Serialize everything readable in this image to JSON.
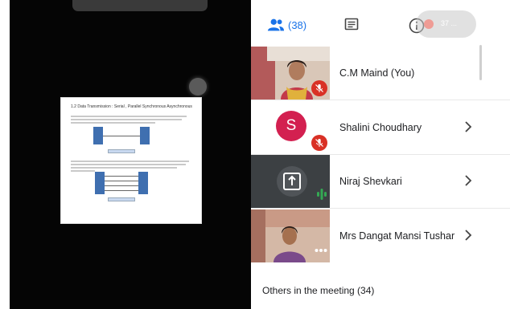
{
  "presentation": {
    "slide_title": "1.2 Data Transmission : Serial , Parallel Synchronous Asynchronous"
  },
  "tabs": {
    "people_count": "(38)"
  },
  "overlay": {
    "timer_text": "37 ..."
  },
  "participants": [
    {
      "name": "C.M Maind (You)",
      "muted": true
    },
    {
      "name": "Shalini Choudhary",
      "avatar_letter": "S",
      "muted": true
    },
    {
      "name": "Niraj Shevkari",
      "presenting": true
    },
    {
      "name": "Mrs Dangat Mansi Tushar"
    }
  ],
  "others_label": "Others in the meeting (34)",
  "colors": {
    "accent": "#1a73e8",
    "muted_badge": "#d93025",
    "avatar_bg": "#d32050",
    "presenter_tile": "#3c4043",
    "audio_bars": "#34a853"
  }
}
